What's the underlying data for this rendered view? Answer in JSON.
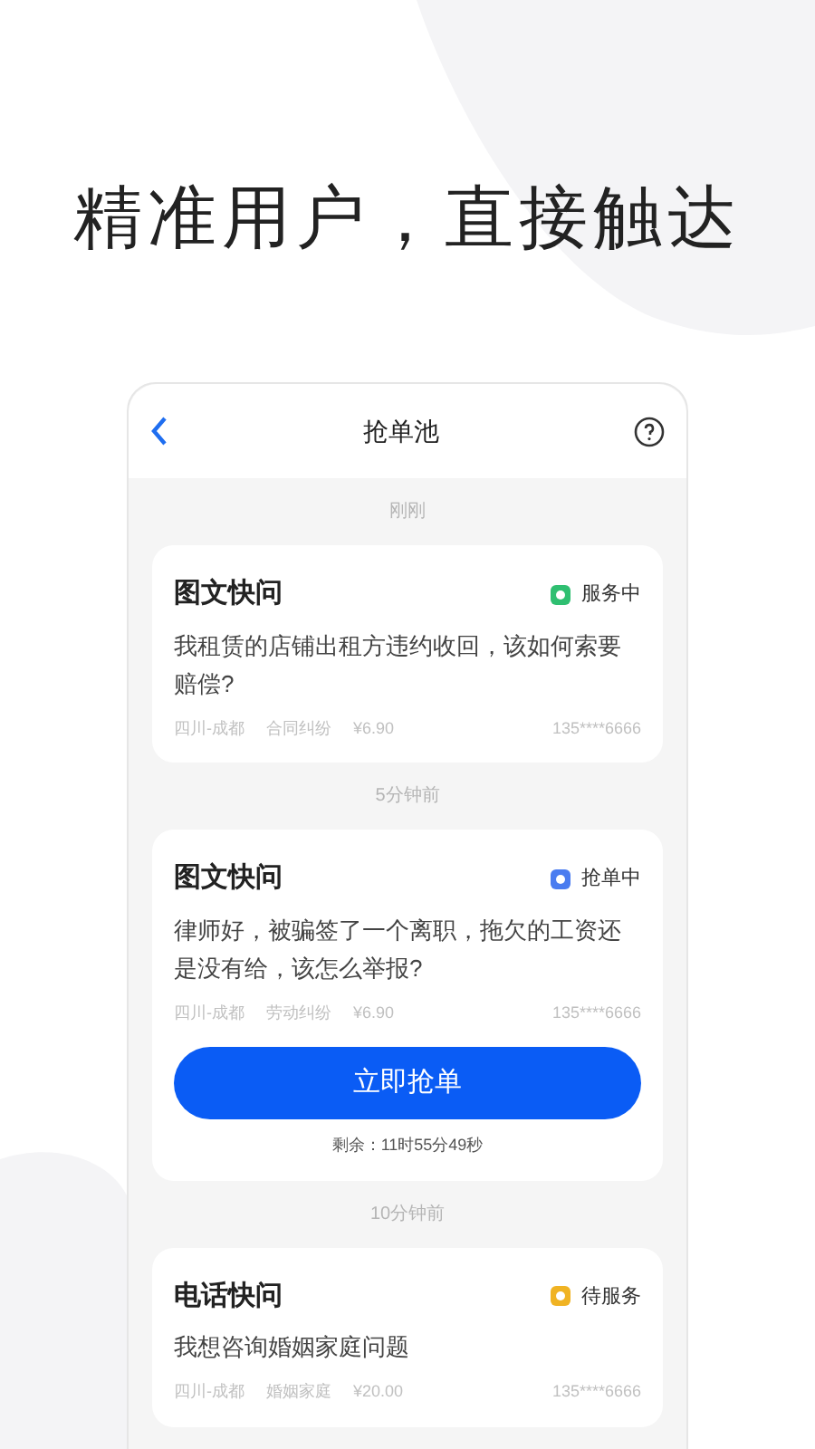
{
  "headline": "精准用户，直接触达",
  "header": {
    "title": "抢单池"
  },
  "groups": [
    {
      "time": "刚刚",
      "card": {
        "type": "图文快问",
        "status": {
          "label": "服务中",
          "color": "#2fbf71"
        },
        "question": "我租赁的店铺出租方违约收回，该如何索要赔偿?",
        "location": "四川-成都",
        "category": "合同纠纷",
        "price": "¥6.90",
        "phone": "135****6666"
      }
    },
    {
      "time": "5分钟前",
      "card": {
        "type": "图文快问",
        "status": {
          "label": "抢单中",
          "color": "#4a7cf0"
        },
        "question": "律师好，被骗签了一个离职，拖欠的工资还是没有给，该怎么举报?",
        "location": "四川-成都",
        "category": "劳动纠纷",
        "price": "¥6.90",
        "phone": "135****6666",
        "action": "立即抢单",
        "remaining": "剩余：11时55分49秒"
      }
    },
    {
      "time": "10分钟前",
      "card": {
        "type": "电话快问",
        "status": {
          "label": "待服务",
          "color": "#f0b323"
        },
        "question": "我想咨询婚姻家庭问题",
        "location": "四川-成都",
        "category": "婚姻家庭",
        "price": "¥20.00",
        "phone": "135****6666"
      }
    }
  ]
}
